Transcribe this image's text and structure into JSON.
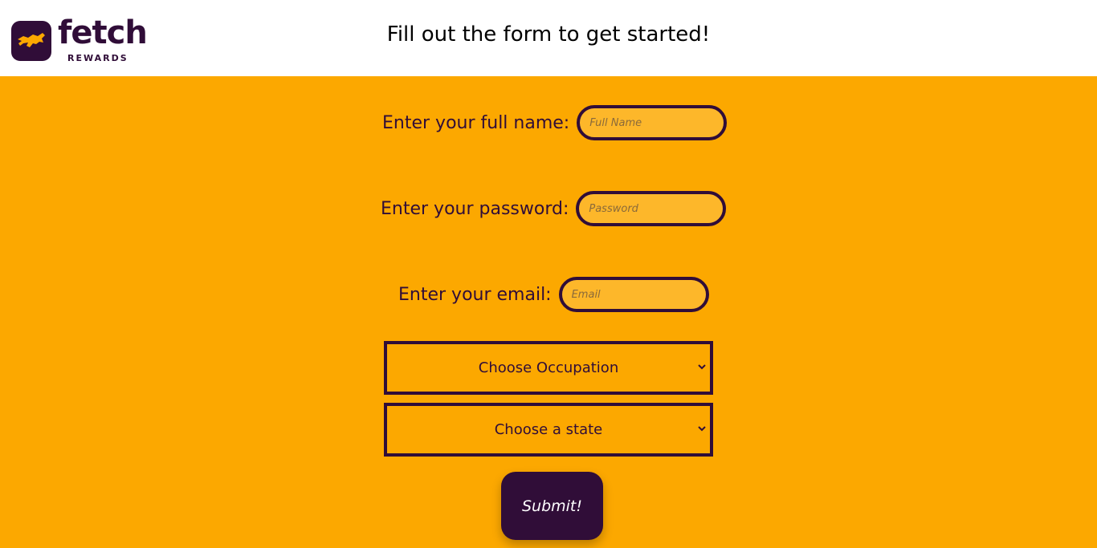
{
  "header": {
    "logo_word": "fetch",
    "logo_sub": "REWARDS",
    "logo_tm": "®",
    "title": "Fill out the form to get started!"
  },
  "form": {
    "name": {
      "label": "Enter your full name:",
      "placeholder": "Full Name",
      "value": ""
    },
    "password": {
      "label": "Enter your password:",
      "placeholder": "Password",
      "value": ""
    },
    "email": {
      "label": "Enter your email:",
      "placeholder": "Email",
      "value": ""
    },
    "occupation": {
      "selected": "Choose Occupation"
    },
    "state": {
      "selected": "Choose a state"
    },
    "submit_label": "Submit!"
  },
  "colors": {
    "brand_purple": "#300d38",
    "background_orange": "#fca800",
    "input_fill": "#fdb72a",
    "header_bg": "#ffffff"
  },
  "icons": [
    "fetch-dog-logo-icon",
    "chevron-down-icon"
  ]
}
